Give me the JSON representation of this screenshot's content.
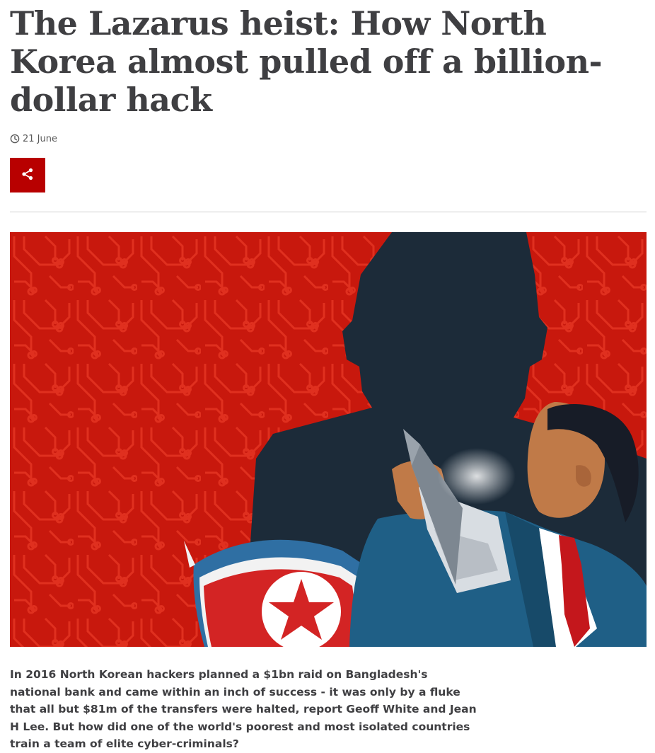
{
  "article": {
    "headline": "The Lazarus heist: How North Korea almost pulled off a billion-dollar hack",
    "date": "21 June",
    "summary": "In 2016 North Korean hackers planned a $1bn raid on Bangladesh's national bank and came within an inch of success - it was only by a fluke that all but $81m of the transfers were halted, report Geoff White and Jean H Lee. But how did one of the world's poorest and most isolated countries train a team of elite cyber-criminals?"
  },
  "icons": {
    "date": "clock-icon",
    "share": "share-icon"
  },
  "colors": {
    "accent": "#b80000",
    "headline": "#3f3f42",
    "divider": "#cfcfcf",
    "hero_red": "#c8180d"
  }
}
